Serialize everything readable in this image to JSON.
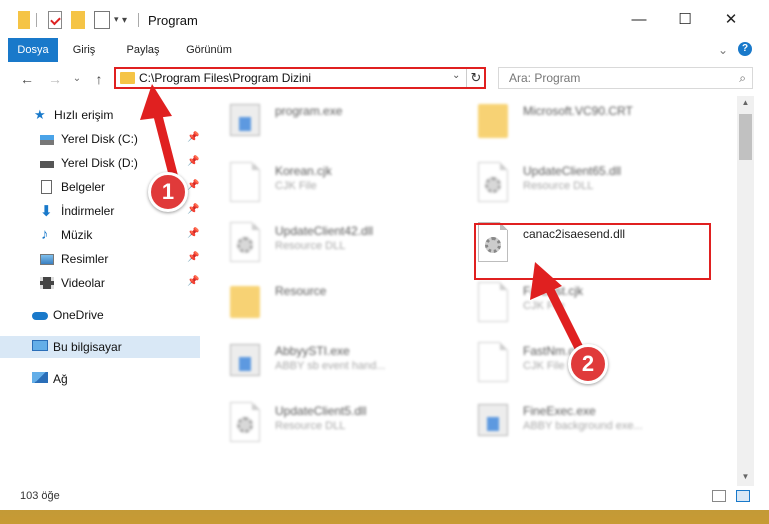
{
  "window": {
    "title": "Program",
    "controls": {
      "minimize": "—",
      "maximize": "☐",
      "close": "✕"
    }
  },
  "ribbon": {
    "tabs": [
      {
        "label": "Dosya",
        "active": true
      },
      {
        "label": "Giriş"
      },
      {
        "label": "Paylaş"
      },
      {
        "label": "Görünüm"
      }
    ],
    "help": "?"
  },
  "nav": {
    "back": "←",
    "forward": "→",
    "history": "⌄",
    "up": "↑",
    "address": "C:\\Program Files\\Program Dizini",
    "search_placeholder": "Ara: Program"
  },
  "sidebar": {
    "items": [
      {
        "label": "Hızlı erişim",
        "icon": "star-icon"
      },
      {
        "label": "Yerel Disk (C:)",
        "icon": "drive-c-icon",
        "pinned": true
      },
      {
        "label": "Yerel Disk (D:)",
        "icon": "drive-d-icon",
        "pinned": true
      },
      {
        "label": "Belgeler",
        "icon": "documents-icon",
        "pinned": true
      },
      {
        "label": "İndirmeler",
        "icon": "downloads-icon",
        "pinned": true
      },
      {
        "label": "Müzik",
        "icon": "music-icon",
        "pinned": true
      },
      {
        "label": "Resimler",
        "icon": "pictures-icon",
        "pinned": true
      },
      {
        "label": "Videolar",
        "icon": "videos-icon",
        "pinned": true
      },
      {
        "label": "OneDrive",
        "icon": "cloud-icon"
      },
      {
        "label": "Bu bilgisayar",
        "icon": "computer-icon",
        "selected": true
      },
      {
        "label": "Ağ",
        "icon": "network-icon"
      }
    ]
  },
  "files": [
    {
      "name": "program.exe",
      "type": ""
    },
    {
      "name": "Microsoft.VC90.CRT",
      "type": ""
    },
    {
      "name": "Korean.cjk",
      "type": "CJK File"
    },
    {
      "name": "UpdateClient65.dll",
      "type": "Resource DLL"
    },
    {
      "name": "UpdateClient42.dll",
      "type": "Resource DLL"
    },
    {
      "name": "canac2isaesend.dll",
      "type": ""
    },
    {
      "name": "Resource",
      "type": ""
    },
    {
      "name": "FarEast.cjk",
      "type": "CJK File"
    },
    {
      "name": "AbbyySTI.exe",
      "type": "ABBY sb event hand..."
    },
    {
      "name": "FastNm.cjk",
      "type": "CJK File"
    },
    {
      "name": "UpdateClient5.dll",
      "type": "Resource DLL"
    },
    {
      "name": "FineExec.exe",
      "type": "ABBY background exe..."
    }
  ],
  "status": {
    "count": "103 öğe"
  },
  "annotations": {
    "step1": "1",
    "step2": "2",
    "color": "#e02020"
  }
}
